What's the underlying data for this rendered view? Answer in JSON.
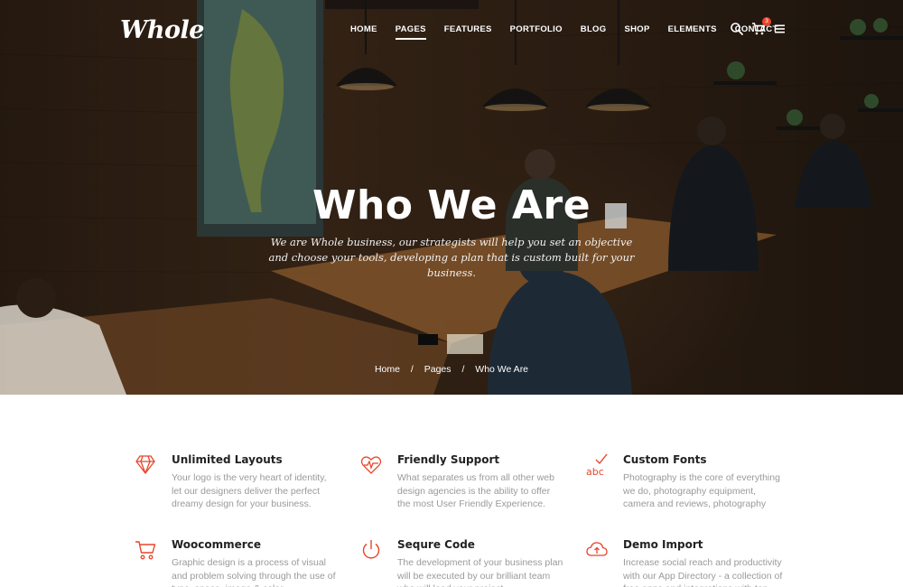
{
  "brand": {
    "logo": "Whole",
    "accent": "#e8452c"
  },
  "nav": {
    "items": [
      {
        "label": "HOME",
        "active": false
      },
      {
        "label": "PAGES",
        "active": true
      },
      {
        "label": "FEATURES",
        "active": false
      },
      {
        "label": "PORTFOLIO",
        "active": false
      },
      {
        "label": "BLOG",
        "active": false
      },
      {
        "label": "SHOP",
        "active": false
      },
      {
        "label": "ELEMENTS",
        "active": false
      },
      {
        "label": "CONTACT",
        "active": false
      }
    ],
    "icons": [
      "search-icon",
      "cart-icon",
      "menu-icon"
    ],
    "cart_count": "3"
  },
  "hero": {
    "title": "Who We Are",
    "subtitle": "We are Whole business, our strategists will help you set an objective and choose your tools, developing a plan that is custom built for your business."
  },
  "breadcrumb": {
    "items": [
      "Home",
      "Pages",
      "Who We Are"
    ],
    "separator": "/"
  },
  "features": [
    {
      "icon": "diamond-icon",
      "title": "Unlimited Layouts",
      "text": "Your logo is the very heart of  identity, let our designers deliver the perfect dreamy design for your business."
    },
    {
      "icon": "heart-pulse-icon",
      "title": "Friendly Support",
      "text": "What separates us from all other web design agencies is the ability to offer the most User Friendly Experience."
    },
    {
      "icon": "abc-check-icon",
      "title": "Custom Fonts",
      "text": "Photography is the core of everything we do, photography equipment, camera and reviews, photography"
    },
    {
      "icon": "cart-outline-icon",
      "title": "Woocommerce",
      "text": "Graphic design is a process of visual and problem solving through the use of type, space, image & color."
    },
    {
      "icon": "power-icon",
      "title": "Sequre Code",
      "text": "The development of your business plan will be executed by our brilliant team who will lead your project."
    },
    {
      "icon": "cloud-upload-icon",
      "title": "Demo Import",
      "text": "Increase social reach and productivity with our App Directory - a collection of free apps and integrations with top tools."
    }
  ]
}
